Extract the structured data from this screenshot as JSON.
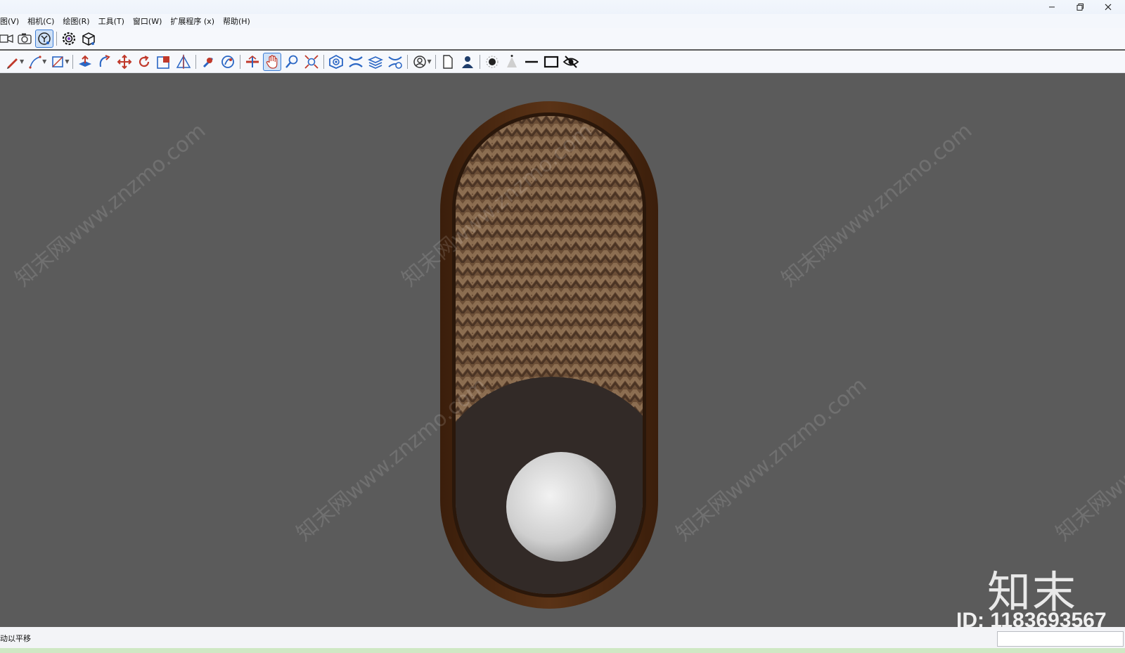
{
  "window": {
    "minimize_icon": "minimize-icon",
    "restore_icon": "restore-icon",
    "close_icon": "close-icon"
  },
  "menu": {
    "items": [
      "图(V)",
      "相机(C)",
      "绘图(R)",
      "工具(T)",
      "窗口(W)",
      "扩展程序 (x)",
      "帮助(H)"
    ]
  },
  "toolbar1": {
    "icons": [
      "video-camera-icon",
      "camera-icon",
      "camera-pin-icon",
      "settings-gear-icon",
      "3d-box-icon"
    ],
    "active": "camera-pin-icon"
  },
  "toolbar2": {
    "icons": [
      "pencil-icon",
      "line-icon",
      "rectangle-icon",
      "push-pull-icon",
      "follow-me-icon",
      "move-icon",
      "rotate-icon",
      "scale-icon",
      "flip-icon",
      "position-camera-icon",
      "walk-icon",
      "section-plane-icon",
      "pan-icon",
      "zoom-icon",
      "zoom-extents-icon",
      "sandbox-icon",
      "layers-icon",
      "layers-stack-icon",
      "layers-settings-icon",
      "user-circle-icon",
      "page-icon",
      "person-icon",
      "dot-icon",
      "cone-icon",
      "minus-icon",
      "square-icon",
      "hide-icon"
    ],
    "active": "pan-icon"
  },
  "viewport": {
    "background": "#5b5b5b",
    "object": {
      "frame_color": "#4a2810",
      "inner_frame_color": "#2e1a0c",
      "weave_colors": [
        "#6e5138",
        "#85694d",
        "#4f3827",
        "#9b7d5d"
      ],
      "cutout_color": "#312a27",
      "sphere_color": "#d8d8d8"
    }
  },
  "watermark": {
    "text": "知末网www.znzmo.com",
    "logo": "知末",
    "id": "ID: 1183693567"
  },
  "status": {
    "text": "动以平移"
  }
}
